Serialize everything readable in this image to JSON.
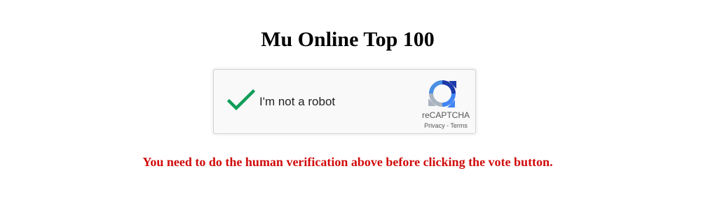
{
  "page": {
    "title": "Mu Online Top 100"
  },
  "captcha": {
    "label": "I'm not a robot",
    "checked": true,
    "brand": "reCAPTCHA",
    "privacy_link": "Privacy",
    "separator": " - ",
    "terms_link": "Terms",
    "check_icon": "checkmark-icon",
    "logo_icon": "recaptcha-logo-icon",
    "check_color": "#0f9d58"
  },
  "message": {
    "warning": "You need to do the human verification above before clicking the vote button.",
    "color": "#d10b0b"
  }
}
